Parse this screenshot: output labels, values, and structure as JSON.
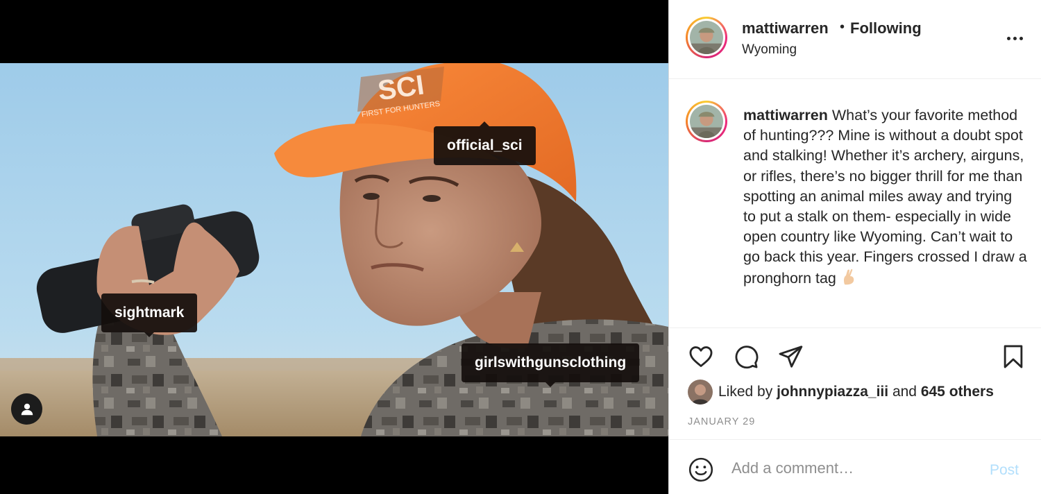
{
  "photo": {
    "tags": {
      "official_sci": "official_sci",
      "sightmark": "sightmark",
      "girlswithgunsclothing": "girlswithgunsclothing"
    },
    "cap_logo_text": "SCI",
    "cap_logo_subtext": "FIRST FOR HUNTERS",
    "user_tag_icon": "person-icon"
  },
  "header": {
    "username": "mattiwarren",
    "separator": "•",
    "follow_status": "Following",
    "location": "Wyoming",
    "more_icon": "more-horizontal-icon"
  },
  "caption": {
    "username": "mattiwarren",
    "text": "What’s your favorite method of hunting??? Mine is without a doubt spot and stalking! Whether it’s archery, airguns, or rifles, there’s no bigger thrill for me than spotting an animal miles away and trying to put a stalk on them- especially in wide open country like Wyoming. Can’t wait to go back this year. Fingers crossed I draw a pronghorn tag",
    "emoji": "crossed-fingers-emoji"
  },
  "actions": {
    "like_icon": "heart-icon",
    "comment_icon": "comment-icon",
    "share_icon": "paper-plane-icon",
    "save_icon": "bookmark-icon"
  },
  "likes": {
    "prefix": "Liked by",
    "user": "johnnypiazza_iii",
    "conjunction": "and",
    "others": "645 others"
  },
  "date": "JANUARY 29",
  "comment": {
    "placeholder": "Add a comment…",
    "post_label": "Post",
    "post_color": "#b2dffc",
    "emoji_icon": "smiley-icon"
  },
  "colors": {
    "cap_orange": "#f57b2e",
    "sky_blue": "#a9d3ef",
    "text_primary": "#262626",
    "text_secondary": "#8e8e8e"
  }
}
